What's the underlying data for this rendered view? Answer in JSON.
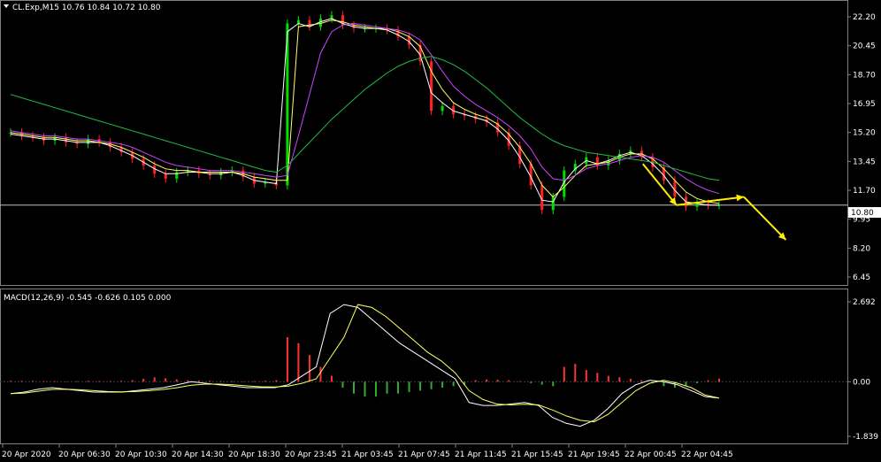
{
  "chart_data": [
    {
      "type": "candlestick",
      "title": "CL.Exp,M15  10.76 10.84 10.72 10.80",
      "symbol": "CL.Exp,M15",
      "ohlc_last": [
        10.76,
        10.84,
        10.72,
        10.8
      ],
      "yticks": [
        "22.20",
        "20.45",
        "18.70",
        "16.95",
        "15.20",
        "13.45",
        "11.70",
        "9.95",
        "8.20",
        "6.45"
      ],
      "ylim": [
        6.45,
        22.2
      ],
      "current_price": 10.8,
      "current_price_label": "10.80",
      "xticks": [
        "20 Apr 2020",
        "20 Apr 06:30",
        "20 Apr 10:30",
        "20 Apr 14:30",
        "20 Apr 18:30",
        "20 Apr 23:45",
        "21 Apr 03:45",
        "21 Apr 07:45",
        "21 Apr 11:45",
        "21 Apr 15:45",
        "21 Apr 19:45",
        "22 Apr 00:45",
        "22 Apr 04:45"
      ],
      "close_series": [
        15.2,
        15.0,
        14.9,
        14.7,
        14.9,
        14.6,
        14.5,
        14.8,
        14.6,
        14.3,
        14.0,
        13.6,
        13.2,
        12.7,
        12.4,
        12.8,
        12.9,
        12.7,
        12.6,
        12.8,
        12.9,
        12.5,
        12.1,
        12.2,
        12.0,
        21.8,
        22.0,
        21.6,
        22.1,
        22.3,
        21.7,
        21.5,
        21.5,
        21.5,
        21.4,
        21.0,
        20.5,
        19.5,
        16.5,
        16.8,
        16.3,
        16.2,
        16.0,
        15.8,
        15.2,
        14.4,
        13.3,
        12.0,
        10.5,
        11.3,
        12.9,
        13.3,
        13.7,
        13.2,
        13.5,
        13.9,
        14.1,
        13.7,
        13.1,
        12.3,
        11.3,
        10.7,
        10.9,
        10.8,
        10.8
      ],
      "ma_lines": [
        {
          "color": "#ffffff",
          "values": [
            15.1,
            15.0,
            14.9,
            14.8,
            14.8,
            14.7,
            14.6,
            14.6,
            14.6,
            14.4,
            14.1,
            13.8,
            13.4,
            13.0,
            12.7,
            12.7,
            12.8,
            12.8,
            12.7,
            12.7,
            12.8,
            12.6,
            12.3,
            12.2,
            12.1,
            21.3,
            21.8,
            21.6,
            21.9,
            22.1,
            21.8,
            21.6,
            21.5,
            21.5,
            21.4,
            21.1,
            20.7,
            19.9,
            17.6,
            17.0,
            16.5,
            16.3,
            16.1,
            15.9,
            15.4,
            14.7,
            13.7,
            12.5,
            11.1,
            11.0,
            12.2,
            13.0,
            13.5,
            13.3,
            13.5,
            13.8,
            14.0,
            13.8,
            13.3,
            12.6,
            11.7,
            11.0,
            10.9,
            10.8,
            10.8
          ]
        },
        {
          "color": "#ffff66",
          "values": [
            15.2,
            15.1,
            15.0,
            14.9,
            14.9,
            14.8,
            14.7,
            14.7,
            14.6,
            14.5,
            14.3,
            14.0,
            13.7,
            13.3,
            13.0,
            12.9,
            12.9,
            12.8,
            12.8,
            12.8,
            12.8,
            12.7,
            12.5,
            12.4,
            12.3,
            12.3,
            21.6,
            21.7,
            21.8,
            22.0,
            21.9,
            21.7,
            21.6,
            21.5,
            21.5,
            21.3,
            21.0,
            20.4,
            18.9,
            17.8,
            17.0,
            16.6,
            16.3,
            16.1,
            15.7,
            15.1,
            14.3,
            13.3,
            12.0,
            11.3,
            11.9,
            12.6,
            13.2,
            13.3,
            13.4,
            13.7,
            13.9,
            13.9,
            13.6,
            13.0,
            12.3,
            11.6,
            11.2,
            11.0,
            10.9
          ]
        },
        {
          "color": "#cc44ff",
          "values": [
            15.3,
            15.2,
            15.1,
            15.0,
            15.0,
            14.9,
            14.8,
            14.8,
            14.7,
            14.6,
            14.5,
            14.3,
            14.0,
            13.7,
            13.4,
            13.2,
            13.1,
            13.0,
            12.9,
            12.9,
            12.9,
            12.8,
            12.7,
            12.6,
            12.5,
            12.6,
            15.0,
            17.5,
            20.0,
            21.3,
            21.7,
            21.8,
            21.7,
            21.6,
            21.5,
            21.4,
            21.2,
            20.8,
            19.9,
            18.9,
            18.0,
            17.4,
            16.9,
            16.5,
            16.1,
            15.6,
            15.0,
            14.2,
            13.1,
            12.4,
            12.3,
            12.6,
            13.0,
            13.2,
            13.3,
            13.5,
            13.7,
            13.8,
            13.7,
            13.4,
            12.9,
            12.4,
            12.0,
            11.7,
            11.5
          ]
        },
        {
          "color": "#22bb44",
          "values": [
            17.5,
            17.3,
            17.1,
            16.9,
            16.7,
            16.5,
            16.3,
            16.1,
            15.9,
            15.7,
            15.5,
            15.3,
            15.1,
            14.9,
            14.7,
            14.5,
            14.3,
            14.1,
            13.9,
            13.7,
            13.5,
            13.3,
            13.1,
            12.9,
            12.8,
            13.2,
            13.9,
            14.6,
            15.3,
            16.0,
            16.6,
            17.2,
            17.8,
            18.3,
            18.8,
            19.2,
            19.5,
            19.7,
            19.8,
            19.6,
            19.3,
            18.9,
            18.4,
            17.9,
            17.3,
            16.7,
            16.1,
            15.6,
            15.1,
            14.7,
            14.4,
            14.2,
            14.0,
            13.9,
            13.8,
            13.7,
            13.6,
            13.5,
            13.4,
            13.2,
            13.0,
            12.8,
            12.6,
            12.4,
            12.3
          ]
        }
      ],
      "annotations": [
        {
          "kind": "arrow",
          "color": "#ffee00",
          "points": [
            [
              0.76,
              13.3
            ],
            [
              0.8,
              10.8
            ]
          ]
        },
        {
          "kind": "arrow",
          "color": "#ffee00",
          "points": [
            [
              0.8,
              10.8
            ],
            [
              0.88,
              11.3
            ]
          ]
        },
        {
          "kind": "arrow",
          "color": "#ffee00",
          "points": [
            [
              0.88,
              11.3
            ],
            [
              0.93,
              8.7
            ]
          ]
        }
      ],
      "colors": {
        "bull": "#00e000",
        "bear": "#ff2222",
        "price_line": "#c0c0c0"
      }
    },
    {
      "type": "macd",
      "title": "MACD(12,26,9) -0.545 -0.626 0.105 0.000",
      "yticks": [
        "2.692",
        "0.00",
        "-1.839"
      ],
      "ylim": [
        -1.839,
        2.692
      ],
      "histogram": [
        0.03,
        0.03,
        0.03,
        0.02,
        0.02,
        0.01,
        0.02,
        0.03,
        0.02,
        0.02,
        0.03,
        0.05,
        0.1,
        0.15,
        0.12,
        0.08,
        0.05,
        0.04,
        0.03,
        0.02,
        0.02,
        0.01,
        0.02,
        0.03,
        0.05,
        1.5,
        1.3,
        0.9,
        0.5,
        0.2,
        -0.2,
        -0.4,
        -0.5,
        -0.5,
        -0.4,
        -0.4,
        -0.35,
        -0.3,
        -0.25,
        -0.2,
        -0.15,
        -0.1,
        0.05,
        0.08,
        0.07,
        0.05,
        0.02,
        -0.05,
        -0.1,
        -0.15,
        0.5,
        0.6,
        0.4,
        0.3,
        0.2,
        0.15,
        0.1,
        0.05,
        -0.05,
        -0.15,
        -0.2,
        -0.15,
        -0.05,
        0.05,
        0.105
      ],
      "macd_line": [
        -0.4,
        -0.35,
        -0.25,
        -0.2,
        -0.25,
        -0.3,
        -0.35,
        -0.35,
        -0.35,
        -0.3,
        -0.25,
        -0.2,
        -0.1,
        0.0,
        -0.05,
        -0.1,
        -0.15,
        -0.2,
        -0.2,
        -0.2,
        -0.1,
        0.2,
        0.5,
        2.3,
        2.6,
        2.5,
        2.1,
        1.7,
        1.3,
        1.0,
        0.7,
        0.4,
        0.1,
        -0.7,
        -0.8,
        -0.8,
        -0.75,
        -0.7,
        -0.8,
        -1.2,
        -1.4,
        -1.5,
        -1.3,
        -0.9,
        -0.4,
        -0.1,
        0.05,
        0.0,
        -0.1,
        -0.3,
        -0.5,
        -0.55
      ],
      "signal_line": [
        -0.4,
        -0.38,
        -0.32,
        -0.26,
        -0.25,
        -0.27,
        -0.3,
        -0.33,
        -0.34,
        -0.33,
        -0.3,
        -0.26,
        -0.2,
        -0.12,
        -0.08,
        -0.08,
        -0.1,
        -0.14,
        -0.17,
        -0.18,
        -0.15,
        -0.05,
        0.1,
        0.8,
        1.5,
        2.6,
        2.5,
        2.2,
        1.8,
        1.4,
        1.0,
        0.7,
        0.3,
        -0.3,
        -0.6,
        -0.75,
        -0.78,
        -0.76,
        -0.78,
        -0.95,
        -1.15,
        -1.3,
        -1.35,
        -1.1,
        -0.7,
        -0.3,
        -0.05,
        0.05,
        -0.05,
        -0.2,
        -0.45,
        -0.55
      ]
    }
  ]
}
